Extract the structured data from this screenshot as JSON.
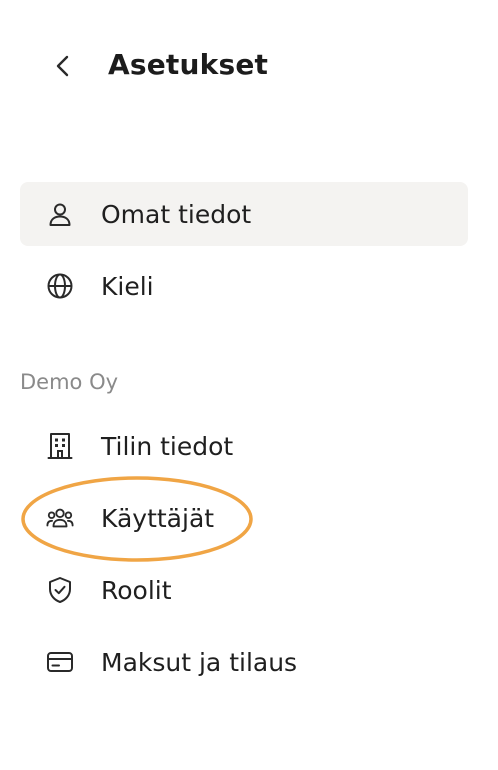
{
  "header": {
    "title": "Asetukset",
    "back_icon": "chevron-left-icon"
  },
  "personal_items": [
    {
      "label": "Omat tiedot",
      "icon": "user-icon",
      "active": true
    },
    {
      "label": "Kieli",
      "icon": "globe-icon",
      "active": false
    }
  ],
  "organization": {
    "name": "Demo Oy",
    "items": [
      {
        "label": "Tilin tiedot",
        "icon": "building-icon"
      },
      {
        "label": "Käyttäjät",
        "icon": "users-icon"
      },
      {
        "label": "Roolit",
        "icon": "shield-check-icon"
      },
      {
        "label": "Maksut ja tilaus",
        "icon": "credit-card-icon"
      }
    ]
  },
  "colors": {
    "active_background": "#f4f3f1",
    "highlight_ring": "#f0a545",
    "text": "#1f1f1f",
    "section_label": "#8a8a8a"
  }
}
